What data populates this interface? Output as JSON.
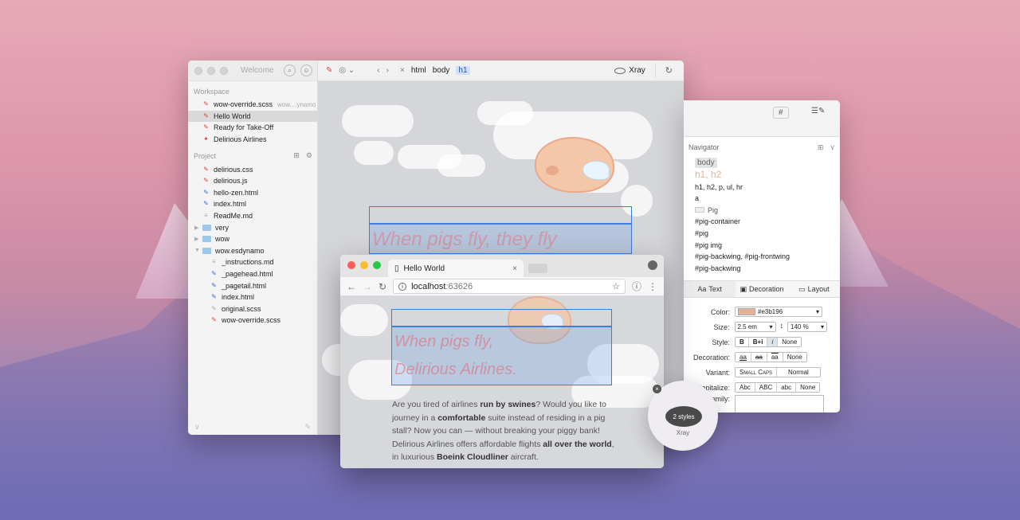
{
  "editor": {
    "sidebar_title": "Welcome",
    "workspace_label": "Workspace",
    "workspace_items": [
      {
        "label": "wow-override.scss",
        "hint": "wow....ynamo"
      },
      {
        "label": "Hello World"
      },
      {
        "label": "Ready for Take-Off"
      },
      {
        "label": "Delirious Airlines"
      }
    ],
    "project_label": "Project",
    "project_items": [
      {
        "label": "delirious.css"
      },
      {
        "label": "delirious.js"
      },
      {
        "label": "hello-zen.html"
      },
      {
        "label": "index.html"
      },
      {
        "label": "ReadMe.md"
      },
      {
        "label": "very"
      },
      {
        "label": "wow"
      },
      {
        "label": "wow.esdynamo"
      },
      {
        "label": "_instructions.md"
      },
      {
        "label": "_pagehead.html"
      },
      {
        "label": "_pagetail.html"
      },
      {
        "label": "index.html"
      },
      {
        "label": "original.scss"
      },
      {
        "label": "wow-override.scss"
      }
    ],
    "breadcrumb": [
      "html",
      "body",
      "h1"
    ],
    "xray_label": "Xray",
    "canvas_heading": "When pigs fly, they fly"
  },
  "browser": {
    "tab_title": "Hello World",
    "url_host": "localhost",
    "url_port": ":63626",
    "heading_line1": "When pigs fly,",
    "heading_line2": "Delirious Airlines.",
    "paragraph": [
      {
        "t": "Are you tired of airlines "
      },
      {
        "b": "run by swines"
      },
      {
        "t": "? Would you like to journey in a "
      },
      {
        "b": "comfortable"
      },
      {
        "t": " suite instead of residing in a pig stall? Now you can — without breaking your piggy bank! Delirious Airlines offers affordable flights "
      },
      {
        "b": "all over the world"
      },
      {
        "t": ", in luxurious "
      },
      {
        "b": "Boeink Cloudliner"
      },
      {
        "t": " aircraft."
      }
    ]
  },
  "inspector": {
    "navigator_label": "Navigator",
    "nav_items": [
      "body",
      "h1, h2",
      "h1, h2, p, ul, hr",
      "a",
      "Pig",
      "#pig-container",
      "#pig",
      "#pig img",
      "#pig-backwing, #pig-frontwing",
      "#pig-backwing"
    ],
    "tabs": [
      "Text",
      "Decoration",
      "Layout"
    ],
    "color_label": "Color:",
    "color_value": "#e3b196",
    "size_label": "Size:",
    "size_value": "2.5 em",
    "line_height_value": "140 %",
    "style_label": "Style:",
    "style_options": [
      "B",
      "B+i",
      "i",
      "None"
    ],
    "decoration_label": "Decoration:",
    "decoration_options": [
      "aa",
      "aa",
      "aa",
      "None"
    ],
    "variant_label": "Variant:",
    "variant_options": [
      "Small Caps",
      "Normal"
    ],
    "capitalize_label": "Capitalize:",
    "capitalize_options": [
      "Abc",
      "ABC",
      "abc",
      "None"
    ],
    "family_label": "Family:",
    "accent_color": "#e3b196"
  },
  "xray_popup": {
    "count_label": "2 styles",
    "caption": "Xray"
  }
}
